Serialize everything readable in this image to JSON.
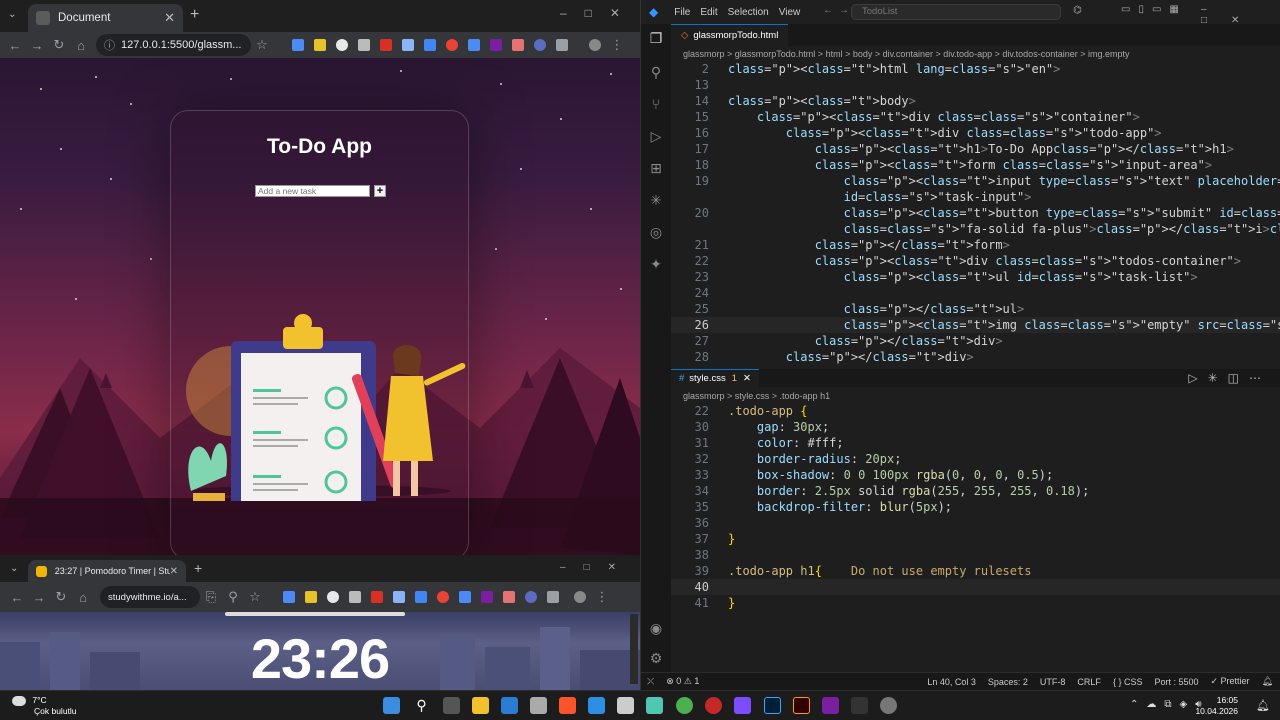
{
  "browser1": {
    "tab_title": "Document",
    "url": "127.0.0.1:5500/glassm...",
    "app": {
      "title": "To-Do App",
      "input_placeholder": "Add a new task",
      "add_button": "+"
    }
  },
  "browser2": {
    "tab_title": "23:27 | Pomodoro Timer | Study",
    "url": "studywithme.io/a...",
    "timer": "23:26"
  },
  "vscode": {
    "menu": [
      "File",
      "Edit",
      "Selection",
      "View"
    ],
    "search": "TodoList",
    "html_tab": "glassmorpTodo.html",
    "html_breadcrumb": "glassmorp  >  glassmorpTodo.html  >  html  >  body  >  div.container  >  div.todo-app  >  div.todos-container  >  img.empty",
    "css_tab": "style.css",
    "css_tab_badge": "1",
    "css_breadcrumb": "glassmorp  >  style.css  >  .todo-app h1",
    "html_lines": [
      {
        "n": "2",
        "code": "<html lang=\"en\">"
      },
      {
        "n": "13",
        "code": ""
      },
      {
        "n": "14",
        "code": "<body>"
      },
      {
        "n": "15",
        "code": "    <div class=\"container\">"
      },
      {
        "n": "16",
        "code": "        <div class=\"todo-app\">"
      },
      {
        "n": "17",
        "code": "            <h1>To-Do App</h1>"
      },
      {
        "n": "18",
        "code": "            <form class=\"input-area\">"
      },
      {
        "n": "19",
        "code": "                <input type=\"text\" placeholder=\"Add a new task\""
      },
      {
        "n": "",
        "code": "                id=\"task-input\">"
      },
      {
        "n": "20",
        "code": "                <button type=\"submit\" id=\"add-task-btn\"><i"
      },
      {
        "n": "",
        "code": "                class=\"fa-solid fa-plus\"></i></button>"
      },
      {
        "n": "21",
        "code": "            </form>"
      },
      {
        "n": "22",
        "code": "            <div class=\"todos-container\">"
      },
      {
        "n": "23",
        "code": "                <ul id=\"task-list\">"
      },
      {
        "n": "24",
        "code": ""
      },
      {
        "n": "25",
        "code": "                </ul>"
      },
      {
        "n": "26",
        "code": "                <img class=\"empty\" src=\"img/empty.png\" alt=\"empty\">"
      },
      {
        "n": "27",
        "code": "            </div>"
      },
      {
        "n": "28",
        "code": "        </div>"
      }
    ],
    "css_lines": [
      {
        "n": "22",
        "code": ".todo-app {"
      },
      {
        "n": "30",
        "code": "    gap: 30px;"
      },
      {
        "n": "31",
        "code": "    color: #fff;"
      },
      {
        "n": "32",
        "code": "    border-radius: 20px;"
      },
      {
        "n": "33",
        "code": "    box-shadow: 0 0 100px rgba(0, 0, 0, 0.5);"
      },
      {
        "n": "34",
        "code": "    border: 2.5px solid rgba(255, 255, 255, 0.18);"
      },
      {
        "n": "35",
        "code": "    backdrop-filter: blur(5px);"
      },
      {
        "n": "36",
        "code": ""
      },
      {
        "n": "37",
        "code": "}"
      },
      {
        "n": "38",
        "code": ""
      },
      {
        "n": "39",
        "code": ".todo-app h1{    Do not use empty rulesets"
      },
      {
        "n": "40",
        "code": ""
      },
      {
        "n": "41",
        "code": "}"
      }
    ],
    "status": {
      "problems": "⊗ 0 ⚠ 1",
      "position": "Ln 40, Col 3",
      "spaces": "Spaces: 2",
      "encoding": "UTF-8",
      "eol": "CRLF",
      "lang": "{ } CSS",
      "port": "Port : 5500",
      "prettier": "✓ Prettier"
    }
  },
  "taskbar": {
    "temp": "7°C",
    "weather": "Çok bulutlu",
    "time": "16:05",
    "date": "10.04.2026"
  }
}
